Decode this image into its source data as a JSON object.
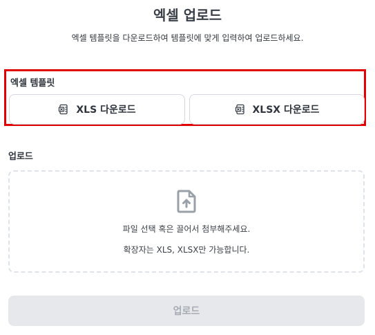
{
  "page": {
    "title": "엑셀 업로드",
    "subtitle": "엑셀 템플릿을 다운로드하여 템플릿에 맞게 입력하여 업로드하세요."
  },
  "template": {
    "label": "엑셀 템플릿",
    "xls_button": "XLS 다운로드",
    "xlsx_button": "XLSX 다운로드",
    "highlight_color": "#e00000"
  },
  "upload": {
    "label": "업로드",
    "drop_text": "파일 선택 혹은 끌어서 첨부해주세요.",
    "drop_hint": "확장자는 XLS, XLSX만 가능합니다.",
    "icon": "file-upload-icon"
  },
  "submit": {
    "label": "업로드",
    "enabled": false
  }
}
